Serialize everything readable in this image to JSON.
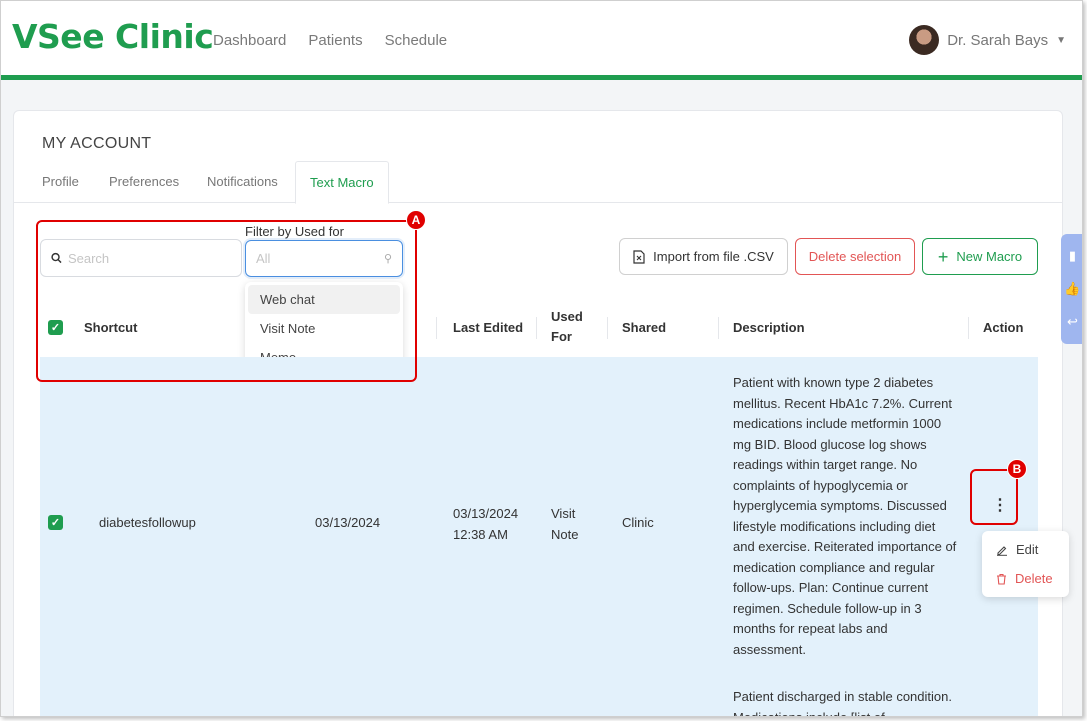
{
  "app": {
    "logo": "VSee Clinic"
  },
  "nav": {
    "items": [
      "Dashboard",
      "Patients",
      "Schedule"
    ]
  },
  "user": {
    "name": "Dr. Sarah Bays"
  },
  "account": {
    "title": "MY ACCOUNT",
    "tabs": [
      "Profile",
      "Preferences",
      "Notifications",
      "Text Macro"
    ],
    "active_tab": "Text Macro"
  },
  "search": {
    "placeholder": "Search",
    "value": ""
  },
  "filter": {
    "label": "Filter by Used for",
    "placeholder": "All",
    "options": [
      "Web chat",
      "Visit Note",
      "Memo"
    ],
    "highlighted": "Web chat"
  },
  "buttons": {
    "import": "Import from file .CSV",
    "delete": "Delete selection",
    "new": "New Macro"
  },
  "table": {
    "headers": {
      "shortcut": "Shortcut",
      "last_edited": "Last Edited",
      "used_for": "Used For",
      "shared": "Shared",
      "description": "Description",
      "action": "Action"
    },
    "rows": [
      {
        "checked": true,
        "shortcut": "diabetesfollowup",
        "created": "03/13/2024",
        "last_edited_date": "03/13/2024",
        "last_edited_time": "12:38 AM",
        "used_for": "Visit Note",
        "shared": "Clinic",
        "description": "Patient with known type 2 diabetes mellitus. Recent HbA1c 7.2%. Current medications include metformin 1000 mg BID. Blood glucose log shows readings within target range. No complaints of hypoglycemia or hyperglycemia symptoms. Discussed lifestyle modifications including diet and exercise. Reiterated importance of medication compliance and regular follow-ups. Plan: Continue current regimen. Schedule follow-up in 3 months for repeat labs and assessment."
      }
    ],
    "next_description": "Patient discharged in stable condition. Medications include [list of"
  },
  "action_menu": {
    "edit": "Edit",
    "delete": "Delete"
  },
  "annotations": {
    "a": "A",
    "b": "B"
  },
  "colors": {
    "brand": "#1f9d4f",
    "danger": "#e25555",
    "annotation": "#e00000",
    "row_selected": "#e3f1fb"
  }
}
